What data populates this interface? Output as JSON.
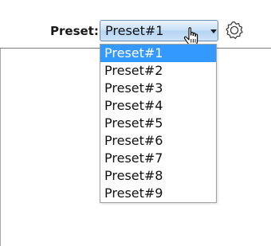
{
  "preset": {
    "label": "Preset:",
    "selected_value": "Preset#1",
    "options": [
      "Preset#1",
      "Preset#2",
      "Preset#3",
      "Preset#4",
      "Preset#5",
      "Preset#6",
      "Preset#7",
      "Preset#8",
      "Preset#9"
    ],
    "highlighted_index": 0
  },
  "icons": {
    "dropdown_arrow": "chevron-down-icon",
    "settings": "gear-icon",
    "cursor": "hand-cursor-icon"
  },
  "colors": {
    "highlight": "#3399ff",
    "select_border": "#6a8cb7"
  }
}
